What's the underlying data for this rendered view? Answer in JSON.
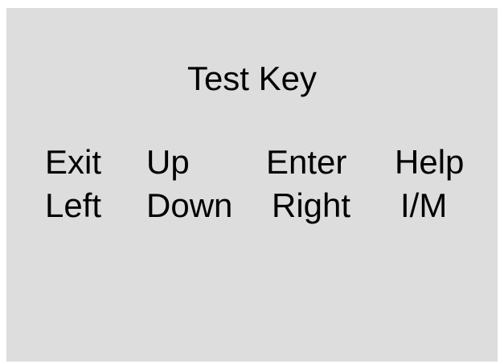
{
  "screen": {
    "title": "Test Key",
    "keys": [
      {
        "label": "Exit"
      },
      {
        "label": "Up"
      },
      {
        "label": "Enter"
      },
      {
        "label": "Help"
      },
      {
        "label": "Left"
      },
      {
        "label": "Down"
      },
      {
        "label": "Right"
      },
      {
        "label": "I/M"
      }
    ]
  }
}
